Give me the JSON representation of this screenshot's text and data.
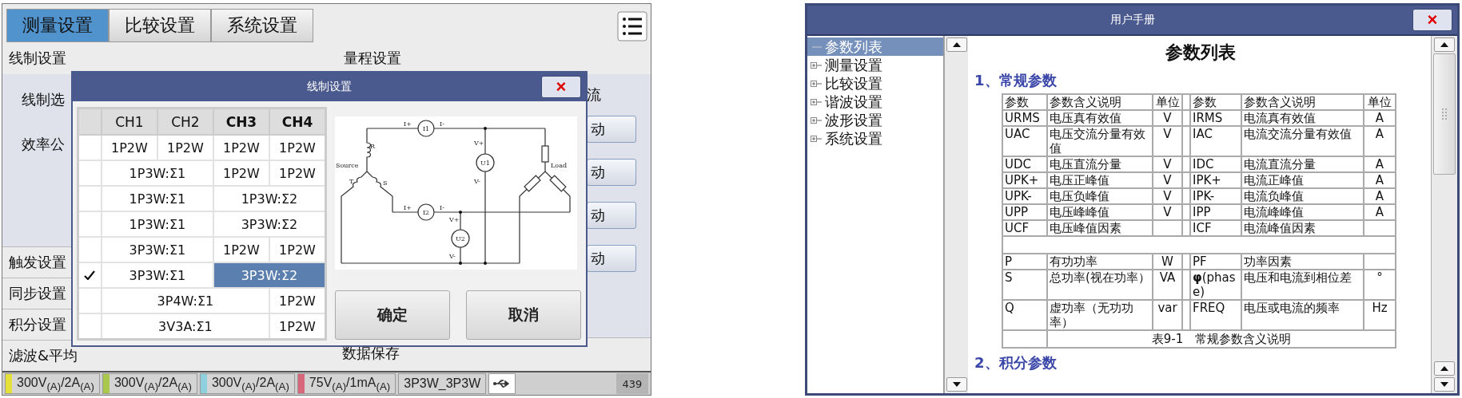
{
  "left_screen": {
    "tabs": [
      {
        "label": "测量设置",
        "selected": true
      },
      {
        "label": "比较设置",
        "selected": false
      },
      {
        "label": "系统设置",
        "selected": false
      }
    ],
    "left_column": {
      "header": "线制设置",
      "fields": [
        "线制选",
        "效率公"
      ],
      "items": [
        "触发设置",
        "同步设置",
        "积分设置",
        "滤波&平均"
      ]
    },
    "right_column": {
      "header": "量程设置",
      "label": "流",
      "buttons": [
        "动",
        "动",
        "动",
        "动"
      ],
      "footer": "数据保存"
    },
    "status_bar": {
      "channels": [
        {
          "text": "300V$_{(A)}$/2A$_{(A)}$",
          "color": "#e6e03a"
        },
        {
          "text": "300V$_{(A)}$/2A$_{(A)}$",
          "color": "#a9c84c"
        },
        {
          "text": "300V$_{(A)}$/2A$_{(A)}$",
          "color": "#8fd0de"
        },
        {
          "text": "75V$_{(A)}$/1mA$_{(A)}$",
          "color": "#d8677c"
        }
      ],
      "mode": "3P3W_3P3W",
      "count": "439"
    },
    "dialog": {
      "title": "线制设置",
      "close": "×",
      "columns": [
        {
          "label": "CH1",
          "bold": false
        },
        {
          "label": "CH2",
          "bold": false
        },
        {
          "label": "CH3",
          "bold": true
        },
        {
          "label": "CH4",
          "bold": true
        }
      ],
      "rows": [
        {
          "checked": false,
          "cells": [
            {
              "text": "1P2W",
              "selected": false
            },
            {
              "text": "1P2W",
              "selected": false
            },
            {
              "text": "1P2W",
              "selected": false
            },
            {
              "text": "1P2W",
              "selected": false
            }
          ]
        },
        {
          "checked": false,
          "cells": [
            {
              "text": "1P3W:Σ1",
              "colspan": 2,
              "selected": false
            },
            {
              "text": "1P2W",
              "selected": false
            },
            {
              "text": "1P2W",
              "selected": false
            }
          ]
        },
        {
          "checked": false,
          "cells": [
            {
              "text": "1P3W:Σ1",
              "colspan": 2,
              "selected": false
            },
            {
              "text": "1P3W:Σ2",
              "colspan": 2,
              "selected": false
            }
          ]
        },
        {
          "checked": false,
          "cells": [
            {
              "text": "1P3W:Σ1",
              "colspan": 2,
              "selected": false
            },
            {
              "text": "3P3W:Σ2",
              "colspan": 2,
              "selected": false
            }
          ]
        },
        {
          "checked": false,
          "cells": [
            {
              "text": "3P3W:Σ1",
              "colspan": 2,
              "selected": false
            },
            {
              "text": "1P2W",
              "selected": false
            },
            {
              "text": "1P2W",
              "selected": false
            }
          ]
        },
        {
          "checked": true,
          "cells": [
            {
              "text": "3P3W:Σ1",
              "colspan": 2,
              "selected": false
            },
            {
              "text": "3P3W:Σ2",
              "colspan": 2,
              "selected": true
            }
          ]
        },
        {
          "checked": false,
          "cells": [
            {
              "text": "3P4W:Σ1",
              "colspan": 3,
              "selected": false
            },
            {
              "text": "1P2W",
              "selected": false
            }
          ]
        },
        {
          "checked": false,
          "cells": [
            {
              "text": "3V3A:Σ1",
              "colspan": 3,
              "selected": false
            },
            {
              "text": "1P2W",
              "selected": false
            }
          ]
        }
      ],
      "circuit_labels": [
        "I+",
        "I1",
        "I-",
        "V+",
        "U1",
        "V-",
        "R",
        "Source",
        "T",
        "S",
        "Load",
        "I+",
        "I2",
        "I-",
        "V+",
        "U2",
        "V-"
      ],
      "buttons": [
        "确定",
        "取消"
      ]
    }
  },
  "manual_window": {
    "title": "用户手册",
    "close": "×",
    "tree": [
      {
        "label": "参数列表",
        "kind": "leaf",
        "selected": true
      },
      {
        "label": "测量设置",
        "kind": "folder",
        "selected": false
      },
      {
        "label": "比较设置",
        "kind": "folder",
        "selected": false
      },
      {
        "label": "谐波设置",
        "kind": "folder",
        "selected": false
      },
      {
        "label": "波形设置",
        "kind": "folder",
        "selected": false
      },
      {
        "label": "系统设置",
        "kind": "folder",
        "selected": false
      }
    ],
    "heading": "参数列表",
    "section_title": "1、常规参数",
    "table": {
      "header": [
        "参数",
        "参数含义说明",
        "单位",
        "参数",
        "参数含义说明",
        "单位"
      ],
      "groups": [
        [
          {
            "param": "URMS",
            "meaning": "电压真有效值",
            "unit": "V",
            "param_2": "IRMS",
            "meaning_2": "电流真有效值",
            "unit_2": "A"
          },
          {
            "param": "UAC",
            "meaning": "电压交流分量有效值",
            "unit": "V",
            "param_2": "IAC",
            "meaning_2": "电流交流分量有效值",
            "unit_2": "A"
          },
          {
            "param": "UDC",
            "meaning": "电压直流分量",
            "unit": "V",
            "param_2": "IDC",
            "meaning_2": "电流直流分量",
            "unit_2": "A"
          },
          {
            "param": "UPK+",
            "meaning": "电压正峰值",
            "unit": "V",
            "param_2": "IPK+",
            "meaning_2": "电流正峰值",
            "unit_2": "A"
          },
          {
            "param": "UPK-",
            "meaning": "电压负峰值",
            "unit": "V",
            "param_2": "IPK-",
            "meaning_2": "电流负峰值",
            "unit_2": "A"
          },
          {
            "param": "UPP",
            "meaning": "电压峰峰值",
            "unit": "V",
            "param_2": "IPP",
            "meaning_2": "电流峰峰值",
            "unit_2": "A"
          },
          {
            "param": "UCF",
            "meaning": "电压峰值因素",
            "param_2": "ICF",
            "meaning_2": "电流峰值因素"
          }
        ],
        [
          {
            "param": "P",
            "meaning": "有功功率",
            "unit": "W",
            "param_2": "PF",
            "meaning_2": "功率因素"
          },
          {
            "param": "S",
            "meaning": "总功率(视在功率）",
            "unit": "VA",
            "param_2": "**φ**(phase)",
            "meaning_2": "电压和电流到相位差",
            "unit_2": "°"
          },
          {
            "param": "Q",
            "meaning": "虚功率（无功功率）",
            "unit": "var",
            "param_2": "FREQ",
            "meaning_2": "电压或电流的频率",
            "unit_2": "Hz"
          }
        ]
      ],
      "caption": "表9-1　常规参数含义说明"
    },
    "next_section_title": "2、积分参数"
  }
}
